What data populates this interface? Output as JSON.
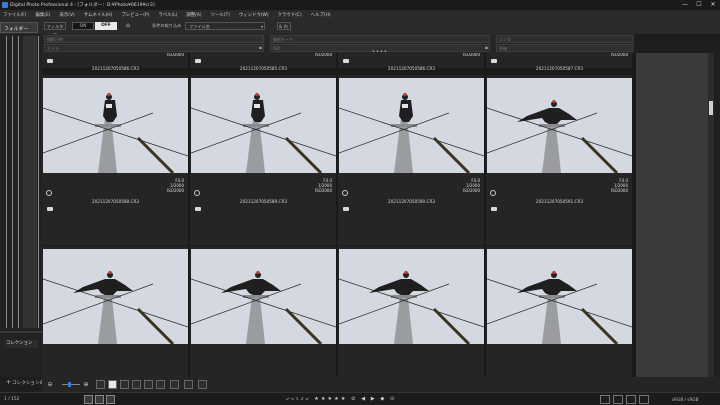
{
  "window": {
    "title": "Digital Photo Professional 4 - [フォルダー：D:¥Photo¥0619¥cr3]",
    "minimize": "—",
    "maximize": "☐",
    "close": "✕"
  },
  "menu": [
    "ファイル(F)",
    "編集(E)",
    "表示(V)",
    "サムネイル(H)",
    "プレビュー(P)",
    "ラベル(L)",
    "調整(A)",
    "ツール(T)",
    "ウィンドウ(W)",
    "クラウド(C)",
    "ヘルプ(H)"
  ],
  "toolbar": {
    "folder_tab": "フォルダー",
    "filter_label": "フィルター",
    "on_label": "ON",
    "off_label": "OFF",
    "condition_label": "条件の絞り込み",
    "condition_value": "ファイル名",
    "and_value": "& 内"
  },
  "filter_fields": [
    {
      "placeholder": "撮影日時"
    },
    {
      "placeholder": "撮影モード"
    },
    {
      "placeholder": "レンズ"
    },
    {
      "placeholder": "カメラ"
    },
    {
      "placeholder": "ISO"
    },
    {
      "placeholder": "評価"
    }
  ],
  "left_panel": {
    "collection_label": "コレクション",
    "add_collection_label": "コレクションの"
  },
  "top_row": [
    {
      "filename": "20211207050586.CR3",
      "iso": "ISO2000"
    },
    {
      "filename": "20211207050585.CR3",
      "iso": "ISO2000"
    },
    {
      "filename": "20211207050586.CR3",
      "iso": "ISO2000"
    },
    {
      "filename": "20211207050587.CR3",
      "iso": "ISO2000"
    }
  ],
  "thumbnails": [
    {
      "filename": "20211207050588.CR3",
      "aperture": "F4.0",
      "shutter": "1/2000",
      "iso": "ISO2000",
      "wings": "folded"
    },
    {
      "filename": "20211207050589.CR3",
      "aperture": "F4.0",
      "shutter": "1/2000",
      "iso": "ISO2000",
      "wings": "folded"
    },
    {
      "filename": "20211207050590.CR3",
      "aperture": "F4.0",
      "shutter": "1/2000",
      "iso": "ISO2000",
      "wings": "folded"
    },
    {
      "filename": "20211207050591.CR3",
      "aperture": "F4.0",
      "shutter": "1/2000",
      "iso": "ISO2000",
      "wings": "spread"
    },
    {
      "wings": "spread"
    },
    {
      "wings": "spread"
    },
    {
      "wings": "spread"
    },
    {
      "wings": "spread"
    }
  ],
  "status": {
    "count": "1 / 152",
    "size": "sRGB / sRGB"
  }
}
